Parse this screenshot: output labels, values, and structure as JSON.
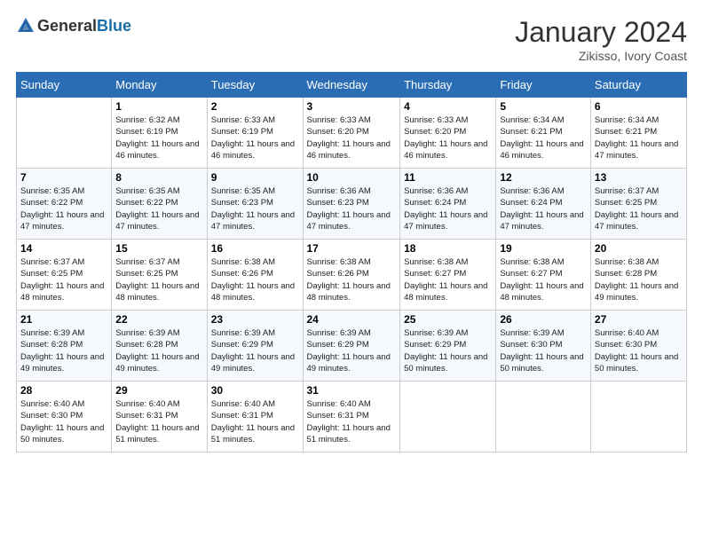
{
  "header": {
    "logo_general": "General",
    "logo_blue": "Blue",
    "month": "January 2024",
    "location": "Zikisso, Ivory Coast"
  },
  "days_of_week": [
    "Sunday",
    "Monday",
    "Tuesday",
    "Wednesday",
    "Thursday",
    "Friday",
    "Saturday"
  ],
  "weeks": [
    [
      {
        "day": "",
        "sunrise": "",
        "sunset": "",
        "daylight": ""
      },
      {
        "day": "1",
        "sunrise": "Sunrise: 6:32 AM",
        "sunset": "Sunset: 6:19 PM",
        "daylight": "Daylight: 11 hours and 46 minutes."
      },
      {
        "day": "2",
        "sunrise": "Sunrise: 6:33 AM",
        "sunset": "Sunset: 6:19 PM",
        "daylight": "Daylight: 11 hours and 46 minutes."
      },
      {
        "day": "3",
        "sunrise": "Sunrise: 6:33 AM",
        "sunset": "Sunset: 6:20 PM",
        "daylight": "Daylight: 11 hours and 46 minutes."
      },
      {
        "day": "4",
        "sunrise": "Sunrise: 6:33 AM",
        "sunset": "Sunset: 6:20 PM",
        "daylight": "Daylight: 11 hours and 46 minutes."
      },
      {
        "day": "5",
        "sunrise": "Sunrise: 6:34 AM",
        "sunset": "Sunset: 6:21 PM",
        "daylight": "Daylight: 11 hours and 46 minutes."
      },
      {
        "day": "6",
        "sunrise": "Sunrise: 6:34 AM",
        "sunset": "Sunset: 6:21 PM",
        "daylight": "Daylight: 11 hours and 47 minutes."
      }
    ],
    [
      {
        "day": "7",
        "sunrise": "Sunrise: 6:35 AM",
        "sunset": "Sunset: 6:22 PM",
        "daylight": "Daylight: 11 hours and 47 minutes."
      },
      {
        "day": "8",
        "sunrise": "Sunrise: 6:35 AM",
        "sunset": "Sunset: 6:22 PM",
        "daylight": "Daylight: 11 hours and 47 minutes."
      },
      {
        "day": "9",
        "sunrise": "Sunrise: 6:35 AM",
        "sunset": "Sunset: 6:23 PM",
        "daylight": "Daylight: 11 hours and 47 minutes."
      },
      {
        "day": "10",
        "sunrise": "Sunrise: 6:36 AM",
        "sunset": "Sunset: 6:23 PM",
        "daylight": "Daylight: 11 hours and 47 minutes."
      },
      {
        "day": "11",
        "sunrise": "Sunrise: 6:36 AM",
        "sunset": "Sunset: 6:24 PM",
        "daylight": "Daylight: 11 hours and 47 minutes."
      },
      {
        "day": "12",
        "sunrise": "Sunrise: 6:36 AM",
        "sunset": "Sunset: 6:24 PM",
        "daylight": "Daylight: 11 hours and 47 minutes."
      },
      {
        "day": "13",
        "sunrise": "Sunrise: 6:37 AM",
        "sunset": "Sunset: 6:25 PM",
        "daylight": "Daylight: 11 hours and 47 minutes."
      }
    ],
    [
      {
        "day": "14",
        "sunrise": "Sunrise: 6:37 AM",
        "sunset": "Sunset: 6:25 PM",
        "daylight": "Daylight: 11 hours and 48 minutes."
      },
      {
        "day": "15",
        "sunrise": "Sunrise: 6:37 AM",
        "sunset": "Sunset: 6:25 PM",
        "daylight": "Daylight: 11 hours and 48 minutes."
      },
      {
        "day": "16",
        "sunrise": "Sunrise: 6:38 AM",
        "sunset": "Sunset: 6:26 PM",
        "daylight": "Daylight: 11 hours and 48 minutes."
      },
      {
        "day": "17",
        "sunrise": "Sunrise: 6:38 AM",
        "sunset": "Sunset: 6:26 PM",
        "daylight": "Daylight: 11 hours and 48 minutes."
      },
      {
        "day": "18",
        "sunrise": "Sunrise: 6:38 AM",
        "sunset": "Sunset: 6:27 PM",
        "daylight": "Daylight: 11 hours and 48 minutes."
      },
      {
        "day": "19",
        "sunrise": "Sunrise: 6:38 AM",
        "sunset": "Sunset: 6:27 PM",
        "daylight": "Daylight: 11 hours and 48 minutes."
      },
      {
        "day": "20",
        "sunrise": "Sunrise: 6:38 AM",
        "sunset": "Sunset: 6:28 PM",
        "daylight": "Daylight: 11 hours and 49 minutes."
      }
    ],
    [
      {
        "day": "21",
        "sunrise": "Sunrise: 6:39 AM",
        "sunset": "Sunset: 6:28 PM",
        "daylight": "Daylight: 11 hours and 49 minutes."
      },
      {
        "day": "22",
        "sunrise": "Sunrise: 6:39 AM",
        "sunset": "Sunset: 6:28 PM",
        "daylight": "Daylight: 11 hours and 49 minutes."
      },
      {
        "day": "23",
        "sunrise": "Sunrise: 6:39 AM",
        "sunset": "Sunset: 6:29 PM",
        "daylight": "Daylight: 11 hours and 49 minutes."
      },
      {
        "day": "24",
        "sunrise": "Sunrise: 6:39 AM",
        "sunset": "Sunset: 6:29 PM",
        "daylight": "Daylight: 11 hours and 49 minutes."
      },
      {
        "day": "25",
        "sunrise": "Sunrise: 6:39 AM",
        "sunset": "Sunset: 6:29 PM",
        "daylight": "Daylight: 11 hours and 50 minutes."
      },
      {
        "day": "26",
        "sunrise": "Sunrise: 6:39 AM",
        "sunset": "Sunset: 6:30 PM",
        "daylight": "Daylight: 11 hours and 50 minutes."
      },
      {
        "day": "27",
        "sunrise": "Sunrise: 6:40 AM",
        "sunset": "Sunset: 6:30 PM",
        "daylight": "Daylight: 11 hours and 50 minutes."
      }
    ],
    [
      {
        "day": "28",
        "sunrise": "Sunrise: 6:40 AM",
        "sunset": "Sunset: 6:30 PM",
        "daylight": "Daylight: 11 hours and 50 minutes."
      },
      {
        "day": "29",
        "sunrise": "Sunrise: 6:40 AM",
        "sunset": "Sunset: 6:31 PM",
        "daylight": "Daylight: 11 hours and 51 minutes."
      },
      {
        "day": "30",
        "sunrise": "Sunrise: 6:40 AM",
        "sunset": "Sunset: 6:31 PM",
        "daylight": "Daylight: 11 hours and 51 minutes."
      },
      {
        "day": "31",
        "sunrise": "Sunrise: 6:40 AM",
        "sunset": "Sunset: 6:31 PM",
        "daylight": "Daylight: 11 hours and 51 minutes."
      },
      {
        "day": "",
        "sunrise": "",
        "sunset": "",
        "daylight": ""
      },
      {
        "day": "",
        "sunrise": "",
        "sunset": "",
        "daylight": ""
      },
      {
        "day": "",
        "sunrise": "",
        "sunset": "",
        "daylight": ""
      }
    ]
  ]
}
